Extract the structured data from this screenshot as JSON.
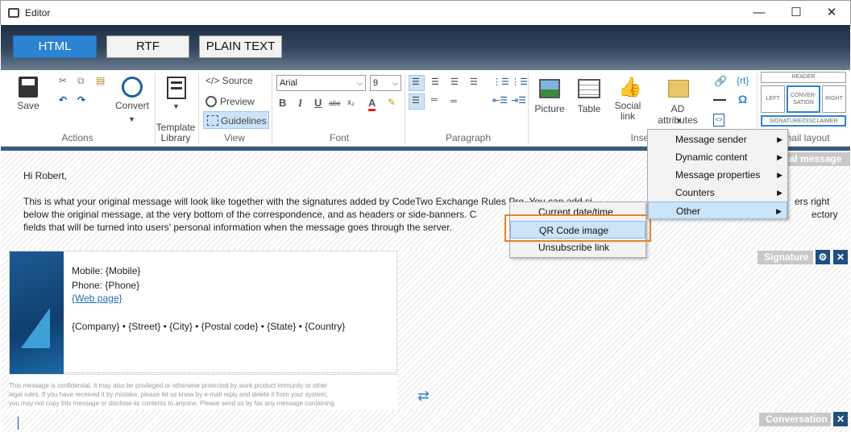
{
  "window": {
    "title": "Editor",
    "minimize": "—",
    "maximize": "☐",
    "close": "✕"
  },
  "format_tabs": [
    {
      "label": "HTML",
      "active": true
    },
    {
      "label": "RTF"
    },
    {
      "label": "PLAIN TEXT"
    }
  ],
  "ribbon": {
    "actions": {
      "save": "Save",
      "convert": "Convert",
      "group": "Actions"
    },
    "template": {
      "label": "Template Library"
    },
    "view": {
      "source": "</> Source",
      "preview": "Preview",
      "guidelines": "Guidelines",
      "group": "View"
    },
    "font": {
      "family": "Arial",
      "size": "9",
      "group": "Font",
      "bold": "B",
      "italic": "I",
      "underline": "U",
      "strike": "abc",
      "color": "A"
    },
    "paragraph": {
      "group": "Paragraph"
    },
    "insert": {
      "picture": "Picture",
      "table": "Table",
      "social": "Social link",
      "ad": "AD attributes",
      "group": "Inse",
      "rt": "{rt}",
      "omega": "Ω"
    },
    "layout": {
      "header": "HEADER",
      "left": "LEFT",
      "conversation": "CONVER-SATION",
      "right": "RIGHT",
      "sig": "SIGNATURE/DISCLAIMER",
      "group": "mail layout"
    }
  },
  "original": {
    "label": "inal message",
    "greeting": "Hi Robert,",
    "line1": "This is what your original message will look like together with the signatures added by CodeTwo Exchange Rules Pro. You can add si",
    "line1b": "ers right",
    "line2": "below the original message, at the very bottom of the correspondence, and as headers or side-banners. C",
    "line2b": "ectory",
    "line3": "fields that will be turned into users' personal information when the message goes through the server."
  },
  "signature": {
    "label": "Signature",
    "mobile": "Mobile:  {Mobile}",
    "phone": "Phone: {Phone}",
    "web": "{Web page}",
    "address": "{Company} • {Street} • {City}  • {Postal code} • {State} • {Country}",
    "disclaimer1": "This message is confidential. It may also be privileged or otherwise protected by work product immunity or other",
    "disclaimer2": "legal rules. If you have received it by mistake, please let us know by e-mail reply and delete it from your system;",
    "disclaimer3": "you may not copy this message or disclose its contents to anyone. Please send us by fax any message containing"
  },
  "conversation": {
    "label": "Conversation"
  },
  "menu_main": [
    {
      "label": "Message sender"
    },
    {
      "label": "Dynamic content"
    },
    {
      "label": "Message properties"
    },
    {
      "label": "Counters"
    },
    {
      "label": "Other",
      "highlighted": true
    }
  ],
  "menu_sub": [
    {
      "label": "Current date/time"
    },
    {
      "label": "QR Code image",
      "highlighted": true
    },
    {
      "label": "Unsubscribe link"
    }
  ],
  "colors": {
    "accent": "#2b83d2",
    "highlight_border": "#e8822a",
    "dark_blue": "#1f4f7f"
  }
}
